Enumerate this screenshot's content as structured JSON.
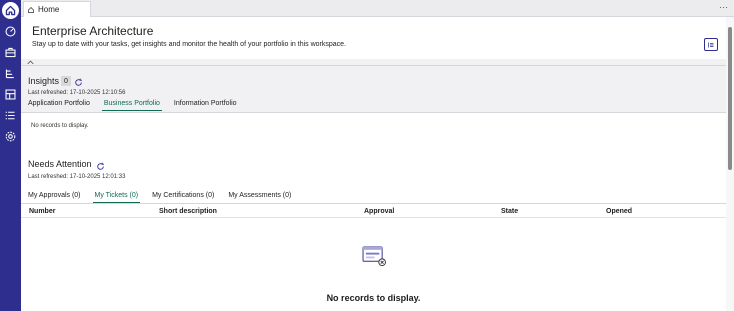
{
  "tab": {
    "label": "Home",
    "icon": "home-icon"
  },
  "topbar": {
    "more_label": "···"
  },
  "hero": {
    "title": "Enterprise Architecture",
    "subtitle": "Stay up to date with your tasks, get insights and monitor the health of your portfolio in this workspace."
  },
  "insights": {
    "title": "Insights",
    "count": "0",
    "last_refreshed": "Last refreshed: 17-10-2025 12:10:56",
    "tabs": [
      "Application Portfolio",
      "Business Portfolio",
      "Information Portfolio"
    ],
    "active_tab": "Business Portfolio",
    "empty_text": "No records to display."
  },
  "attention": {
    "title": "Needs Attention",
    "last_refreshed": "Last refreshed: 17-10-2025 12:01:33",
    "tabs": [
      "My Approvals (0)",
      "My Tickets (0)",
      "My Certifications (0)",
      "My Assessments (0)"
    ],
    "active_tab": "My Tickets (0)",
    "columns": [
      "Number",
      "Short description",
      "Approval",
      "State",
      "Opened"
    ],
    "empty_text": "No records to display."
  },
  "colors": {
    "sidebar": "#2e2e8f",
    "accent": "#0d6b56"
  }
}
